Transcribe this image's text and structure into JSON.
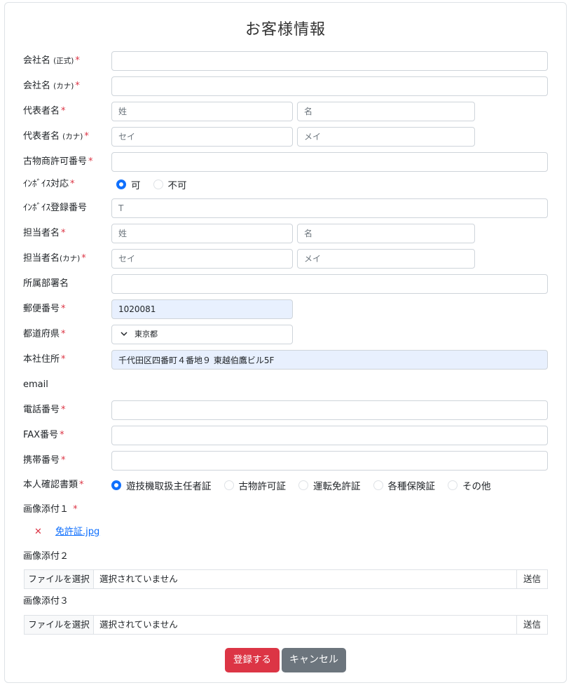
{
  "form": {
    "title": "お客様情報",
    "required_mark": "*",
    "fields": {
      "company_name": {
        "label": "会社名",
        "sub": "(正式)",
        "value": ""
      },
      "company_kana": {
        "label": "会社名",
        "sub": "(カナ)",
        "value": ""
      },
      "rep_name": {
        "label": "代表者名",
        "last_placeholder": "姓",
        "first_placeholder": "名"
      },
      "rep_kana": {
        "label": "代表者名",
        "sub": "(カナ)",
        "last_placeholder": "セイ",
        "first_placeholder": "メイ"
      },
      "antique_license": {
        "label": "古物商許可番号",
        "value": ""
      },
      "invoice": {
        "label": "ｲﾝﾎﾞｲｽ対応",
        "options": [
          "可",
          "不可"
        ],
        "selected": "可"
      },
      "invoice_reg": {
        "label": "ｲﾝﾎﾞｲｽ登録番号",
        "placeholder": "T"
      },
      "staff_name": {
        "label": "担当者名",
        "last_placeholder": "姓",
        "first_placeholder": "名"
      },
      "staff_kana": {
        "label": "担当者名",
        "sub": "(カナ)",
        "last_placeholder": "セイ",
        "first_placeholder": "メイ"
      },
      "department": {
        "label": "所属部署名",
        "value": ""
      },
      "postal": {
        "label": "郵便番号",
        "value": "1020081"
      },
      "prefecture": {
        "label": "都道府県",
        "value": "東京都",
        "icon": "chevron-down-icon"
      },
      "address": {
        "label": "本社住所",
        "value": "千代田区四番町４番地９ 東越伯鷹ビル5F"
      },
      "email": {
        "label": "email"
      },
      "phone": {
        "label": "電話番号",
        "value": ""
      },
      "fax": {
        "label": "FAX番号",
        "value": ""
      },
      "mobile": {
        "label": "携帯番号",
        "value": ""
      },
      "id_doc": {
        "label": "本人確認書類",
        "options": [
          "遊技機取扱主任者証",
          "古物許可証",
          "運転免許証",
          "各種保険証",
          "その他"
        ],
        "selected": "遊技機取扱主任者証"
      },
      "image1": {
        "label": "画像添付１",
        "file_name": "免許証.jpg",
        "remove_icon": "close-icon"
      },
      "image2": {
        "label": "画像添付２",
        "choose_label": "ファイルを選択",
        "status": "選択されていません",
        "send_label": "送信"
      },
      "image3": {
        "label": "画像添付３",
        "choose_label": "ファイルを選択",
        "status": "選択されていません",
        "send_label": "送信"
      }
    },
    "buttons": {
      "submit": "登録する",
      "cancel": "キャンセル"
    }
  },
  "colors": {
    "required": "#dc3545",
    "primary": "#0d6efd",
    "submit_bg": "#dc3545",
    "cancel_bg": "#6c757d",
    "autofill_bg": "#e8f0fe"
  }
}
